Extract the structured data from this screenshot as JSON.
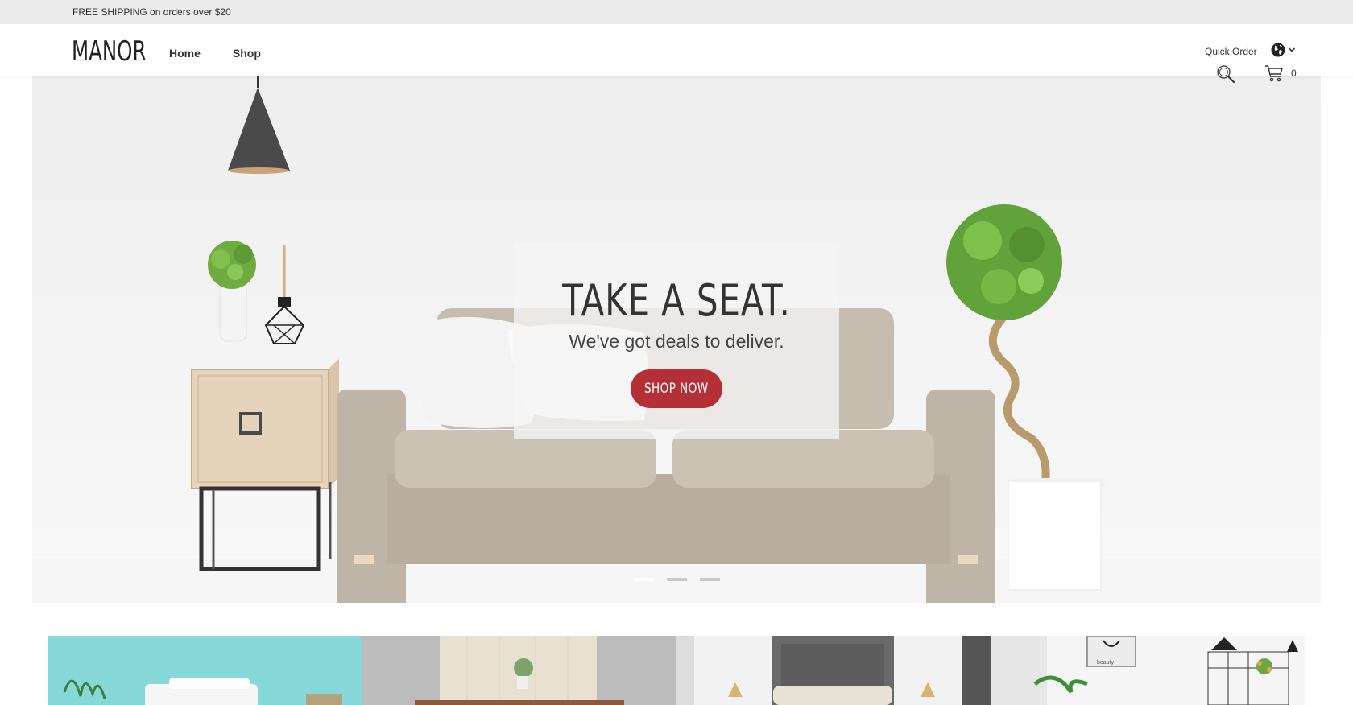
{
  "promo": {
    "text": "FREE SHIPPING on orders over $20"
  },
  "header": {
    "logo": "MANOR",
    "nav": [
      "Home",
      "Shop"
    ],
    "quick_order": "Quick Order",
    "cart_count": "0"
  },
  "hero": {
    "title": "TAKE A SEAT.",
    "subtitle": "We've got deals to deliver.",
    "cta": "SHOP NOW",
    "slides_total": 3,
    "active_slide": 1
  },
  "colors": {
    "accent": "#b53036",
    "promo_bg": "#ebebeb",
    "text": "#333333"
  },
  "icons": [
    "globe-icon",
    "chevron-down-icon",
    "search-icon",
    "cart-icon"
  ]
}
